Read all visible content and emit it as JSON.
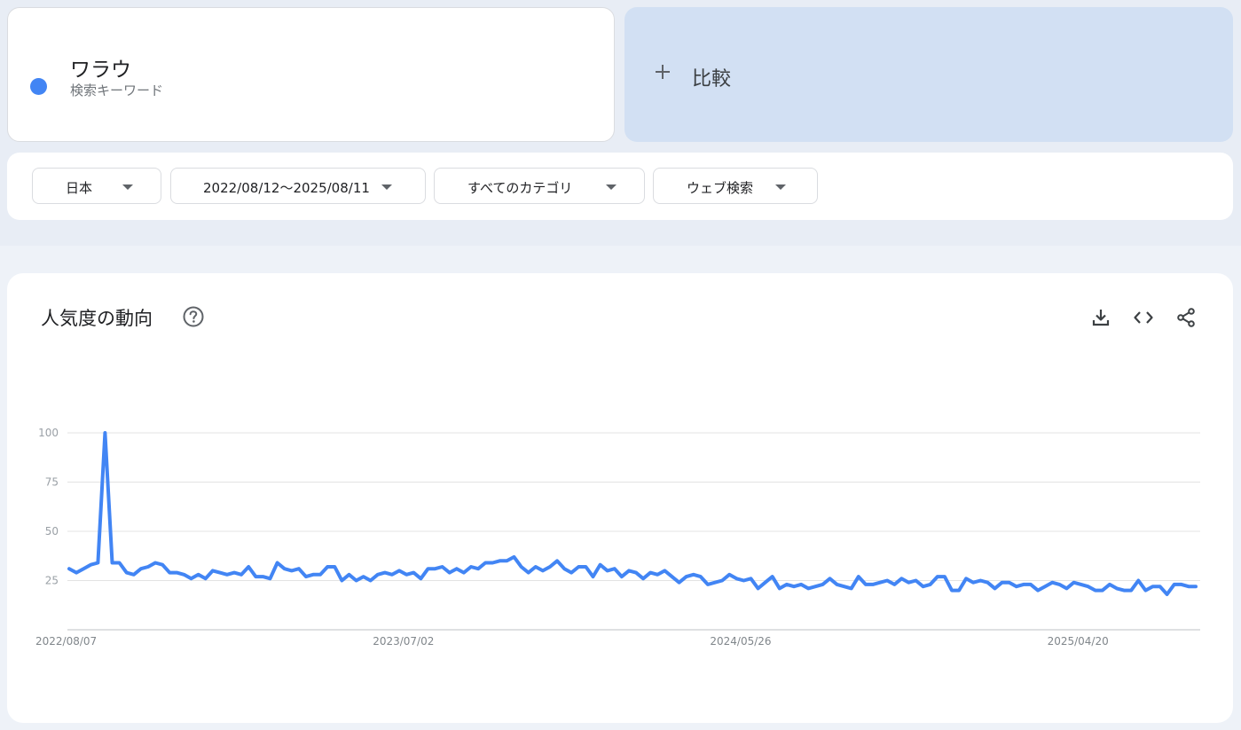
{
  "search_term": {
    "name": "ワラウ",
    "type_label": "検索キーワード",
    "color": "#4285f4"
  },
  "compare": {
    "label": "比較",
    "icon": "plus-icon"
  },
  "filters": [
    {
      "label": "日本",
      "icon": "caret-down-icon"
    },
    {
      "label": "2022/08/12〜2025/08/11",
      "icon": "caret-down-icon"
    },
    {
      "label": "すべてのカテゴリ",
      "icon": "caret-down-icon"
    },
    {
      "label": "ウェブ検索",
      "icon": "caret-down-icon"
    }
  ],
  "chart_section": {
    "title": "人気度の動向",
    "help_icon": "help-icon",
    "actions": [
      "download-icon",
      "embed-code-icon",
      "share-icon"
    ]
  },
  "chart_data": {
    "type": "line",
    "x_start": "2022-08-07",
    "interval_days": 7,
    "x_tick_labels": [
      "2022/08/07",
      "2023/07/02",
      "2024/05/26",
      "2025/04/20"
    ],
    "y_ticks": [
      25,
      50,
      75,
      100
    ],
    "ylim": [
      0,
      100
    ],
    "grid": true,
    "series": [
      {
        "name": "ワラウ",
        "color": "#4285f4",
        "values": [
          31,
          29,
          31,
          33,
          34,
          100,
          34,
          34,
          29,
          28,
          31,
          32,
          34,
          33,
          29,
          29,
          28,
          26,
          28,
          26,
          30,
          29,
          28,
          29,
          28,
          32,
          27,
          27,
          26,
          34,
          31,
          30,
          31,
          27,
          28,
          28,
          32,
          32,
          25,
          28,
          25,
          27,
          25,
          28,
          29,
          28,
          30,
          28,
          29,
          26,
          31,
          31,
          32,
          29,
          31,
          29,
          32,
          31,
          34,
          34,
          35,
          35,
          37,
          32,
          29,
          32,
          30,
          32,
          35,
          31,
          29,
          32,
          32,
          27,
          33,
          30,
          31,
          27,
          30,
          29,
          26,
          29,
          28,
          30,
          27,
          24,
          27,
          28,
          27,
          23,
          24,
          25,
          28,
          26,
          25,
          26,
          21,
          24,
          27,
          21,
          23,
          22,
          23,
          21,
          22,
          23,
          26,
          23,
          22,
          21,
          27,
          23,
          23,
          24,
          25,
          23,
          26,
          24,
          25,
          22,
          23,
          27,
          27,
          20,
          20,
          26,
          24,
          25,
          24,
          21,
          24,
          24,
          22,
          23,
          23,
          20,
          22,
          24,
          23,
          21,
          24,
          23,
          22,
          20,
          20,
          23,
          21,
          20,
          20,
          25,
          20,
          22,
          22,
          18,
          23,
          23,
          22,
          22
        ]
      }
    ]
  }
}
